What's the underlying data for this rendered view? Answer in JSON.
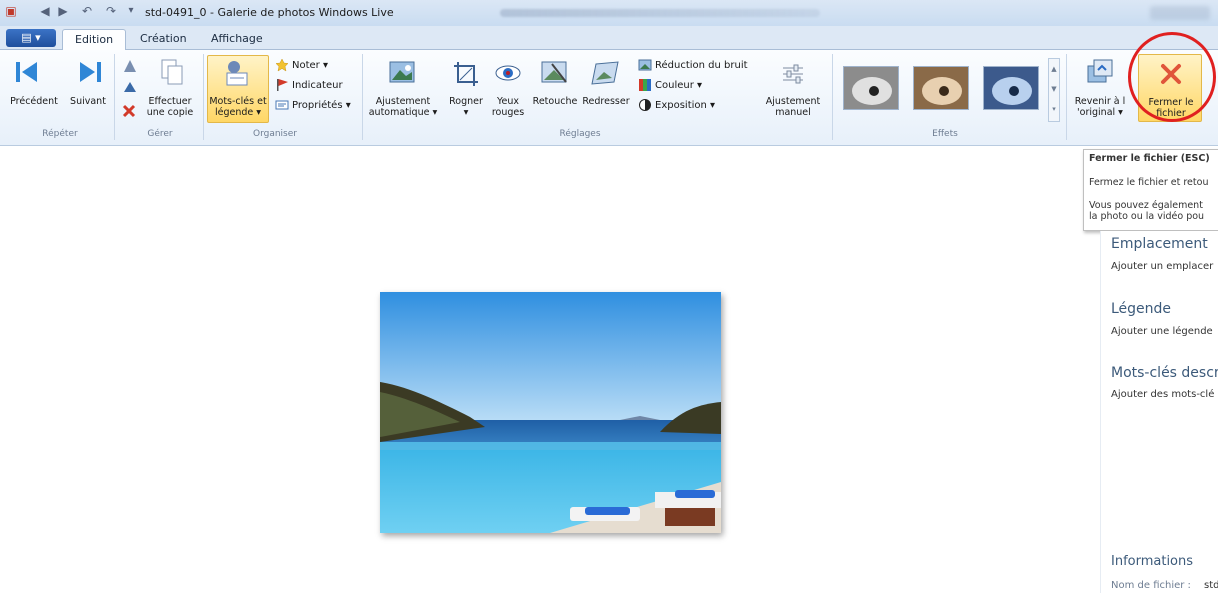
{
  "window": {
    "title": "std-0491_0 - Galerie de photos Windows Live"
  },
  "tabs": [
    {
      "label": "Edition"
    },
    {
      "label": "Création"
    },
    {
      "label": "Affichage"
    }
  ],
  "ribbon": {
    "repeter": {
      "label": "Répéter",
      "precedent": "Précédent",
      "suivant": "Suivant"
    },
    "gerer": {
      "label": "Gérer",
      "effectuer_1": "Effectuer",
      "effectuer_2": "une copie"
    },
    "organiser": {
      "label": "Organiser",
      "mots_cles_1": "Mots-clés et",
      "mots_cles_2": "légende ▾",
      "noter": "Noter ▾",
      "indicateur": "Indicateur",
      "proprietes": "Propriétés ▾"
    },
    "reglages": {
      "label": "Réglages",
      "ajustement_1": "Ajustement",
      "ajustement_2": "automatique ▾",
      "rogner": "Rogner",
      "rogner_arrow": "▾",
      "yeux_1": "Yeux",
      "yeux_2": "rouges",
      "retouche": "Retouche",
      "redresser": "Redresser",
      "reduction": "Réduction du bruit",
      "couleur": "Couleur ▾",
      "exposition": "Exposition ▾",
      "ajust_manuel_1": "Ajustement",
      "ajust_manuel_2": "manuel"
    },
    "effets": {
      "label": "Effets"
    },
    "revenir_1": "Revenir à l",
    "revenir_2": "'original ▾",
    "fermer_1": "Fermer le",
    "fermer_2": "fichier"
  },
  "tooltip": {
    "title": "Fermer le fichier (ESC)",
    "line1": "Fermez le fichier et retou",
    "line2": "Vous pouvez également",
    "line3": "la photo ou la vidéo pou"
  },
  "side_panel": {
    "emplacement": "Emplacement",
    "emplacement_sub": "Ajouter un emplacer",
    "legende": "Légende",
    "legende_sub": "Ajouter une légende",
    "mots_cles": "Mots-clés descrip",
    "mots_cles_sub": "Ajouter des mots-clé",
    "informations": "Informations",
    "nom_fichier": "Nom de fichier :",
    "nom_fichier_val": "std"
  },
  "colors": {
    "accent": "#1f4f9c",
    "highlight": "#ffd766",
    "annotation_circle": "#e02020"
  }
}
